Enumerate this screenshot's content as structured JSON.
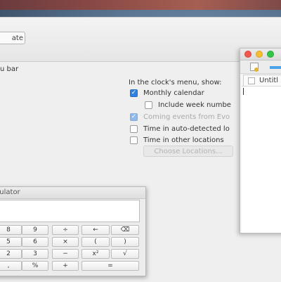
{
  "settings": {
    "tab_label": "ate",
    "menu_bar_label": "u bar",
    "clock_heading": "In the clock's menu, show:",
    "options": [
      {
        "label": "Monthly calendar",
        "checked": true,
        "enabled": true
      },
      {
        "label": "Include week numbe",
        "checked": false,
        "enabled": true
      },
      {
        "label": "Coming events from Evo",
        "checked": true,
        "enabled": false
      },
      {
        "label": "Time in auto-detected lo",
        "checked": false,
        "enabled": true
      },
      {
        "label": "Time in other locations",
        "checked": false,
        "enabled": true
      }
    ],
    "choose_locations_label": "Choose Locations..."
  },
  "editor": {
    "tab_label": "Untitl"
  },
  "calculator": {
    "title": "lculator",
    "keys": [
      [
        "8",
        "9",
        "÷",
        "←",
        "⌫"
      ],
      [
        "5",
        "6",
        "×",
        "(",
        ")"
      ],
      [
        "2",
        "3",
        "−",
        "x²",
        "√"
      ],
      [
        ",",
        "%",
        "+",
        "="
      ]
    ]
  }
}
